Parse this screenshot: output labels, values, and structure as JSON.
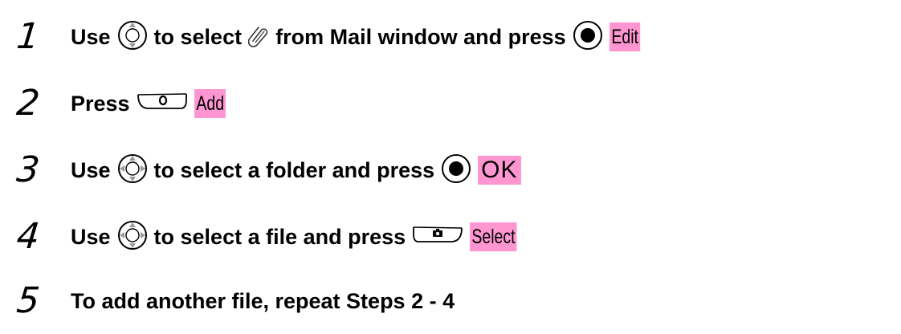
{
  "steps": [
    {
      "number": "1",
      "parts": {
        "a": "Use",
        "b": "to select",
        "c": "from Mail window and press",
        "key": "Edit"
      },
      "icons": [
        "navigation-key-up-down-icon",
        "attachment-paperclip-icon",
        "center-select-key-icon"
      ]
    },
    {
      "number": "2",
      "parts": {
        "a": "Press",
        "key": "Add"
      },
      "icons": [
        "left-soft-key-icon"
      ]
    },
    {
      "number": "3",
      "parts": {
        "a": "Use",
        "b": "to select a folder and press",
        "key": "OK"
      },
      "icons": [
        "navigation-key-four-way-icon",
        "center-select-key-icon"
      ]
    },
    {
      "number": "4",
      "parts": {
        "a": "Use",
        "b": "to select a file and press",
        "key": "Select"
      },
      "icons": [
        "navigation-key-four-way-icon",
        "right-soft-key-camera-icon"
      ]
    },
    {
      "number": "5",
      "parts": {
        "a": "To add another file, repeat Steps 2 - 4"
      },
      "icons": []
    }
  ],
  "colors": {
    "highlight": "#ff96d2",
    "text": "#000000"
  }
}
